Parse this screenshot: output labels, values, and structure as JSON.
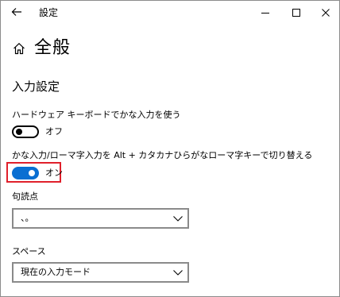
{
  "window": {
    "title": "設定",
    "back_icon": "back-arrow-icon",
    "controls": [
      "minimize-icon",
      "maximize-icon",
      "close-icon"
    ]
  },
  "header": {
    "icon": "home-icon",
    "title": "全般"
  },
  "section": {
    "title": "入力設定"
  },
  "settings": {
    "hardware_keyboard": {
      "label": "ハードウェア キーボードでかな入力を使う",
      "state": "オフ",
      "on": false
    },
    "kana_romaji_switch": {
      "label": "かな入力/ローマ字入力を Alt + カタカナひらがなローマ字キーで切り替える",
      "state": "オン",
      "on": true
    },
    "punctuation": {
      "label": "句読点",
      "value": "、。"
    },
    "space": {
      "label": "スペース",
      "value": "現在の入力モード"
    }
  },
  "colors": {
    "accent": "#0a6fd2",
    "highlight": "#e0202b",
    "border": "#8a8a8a"
  }
}
